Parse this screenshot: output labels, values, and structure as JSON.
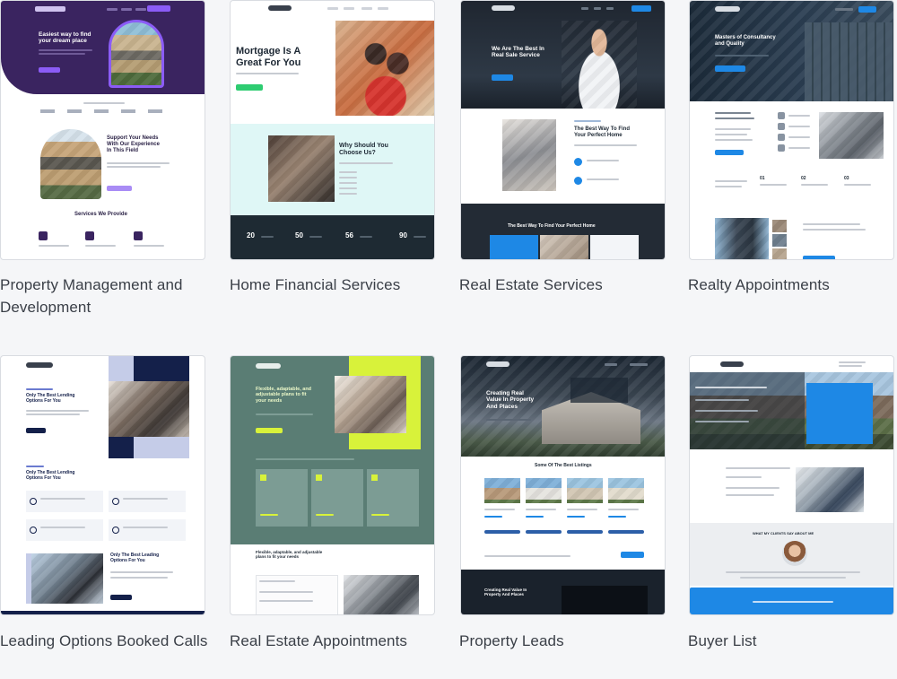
{
  "templates": [
    {
      "title": "Property Management and Development"
    },
    {
      "title": "Home Financial Services"
    },
    {
      "title": "Real Estate Services"
    },
    {
      "title": "Realty Appointments"
    },
    {
      "title": "Leading Options Booked Calls"
    },
    {
      "title": "Real Estate Appointments"
    },
    {
      "title": "Property Leads"
    },
    {
      "title": "Buyer List"
    }
  ],
  "previews": {
    "c1": {
      "hero": "Easiest way to find\nyour dream place",
      "mid": "Support Your Needs\nWith Our Experience\nIn This Field",
      "services": "Services We Provide"
    },
    "c2": {
      "hero": "Mortgage Is A\nGreat For You",
      "why": "Why Should You\nChoose Us?",
      "stats": [
        "20",
        "50",
        "56",
        "90"
      ]
    },
    "c3": {
      "hero": "We Are The Best In\nReal Sale Service",
      "mid": "The Best Way To Find\nYour Perfect Home",
      "band": "The Best Way To Find Your Perfect Home"
    },
    "c4": {
      "hero": "Masters of Consultancy\nand Quality"
    },
    "c5": {
      "hero": "Only The Best Lending\nOptions For You",
      "mid": "Only The Best Lending\nOptions For You",
      "low": "Only The Best Leading\nOptions For You"
    },
    "c6": {
      "hero": "Flexible, adaptable, and\nadjustable plans to fit\nyour needs",
      "low": "Flexible, adaptable, and adjustable\nplans to fit your needs"
    },
    "c7": {
      "hero": "Creating Real\nValue In Property\nAnd Places",
      "listings": "Some Of The Best Listings",
      "low": "Creating Real Value In\nProperty And Places"
    },
    "c8": {
      "about": "WHAT MY CLIENTS SAY ABOUT ME"
    }
  },
  "colors": {
    "purple": "#3a2460",
    "violet": "#8b5cf6",
    "navy": "#14204a",
    "teal": "#5a7d74",
    "lime": "#d8f23a",
    "blue": "#1e88e5",
    "dark": "#1f2733"
  }
}
